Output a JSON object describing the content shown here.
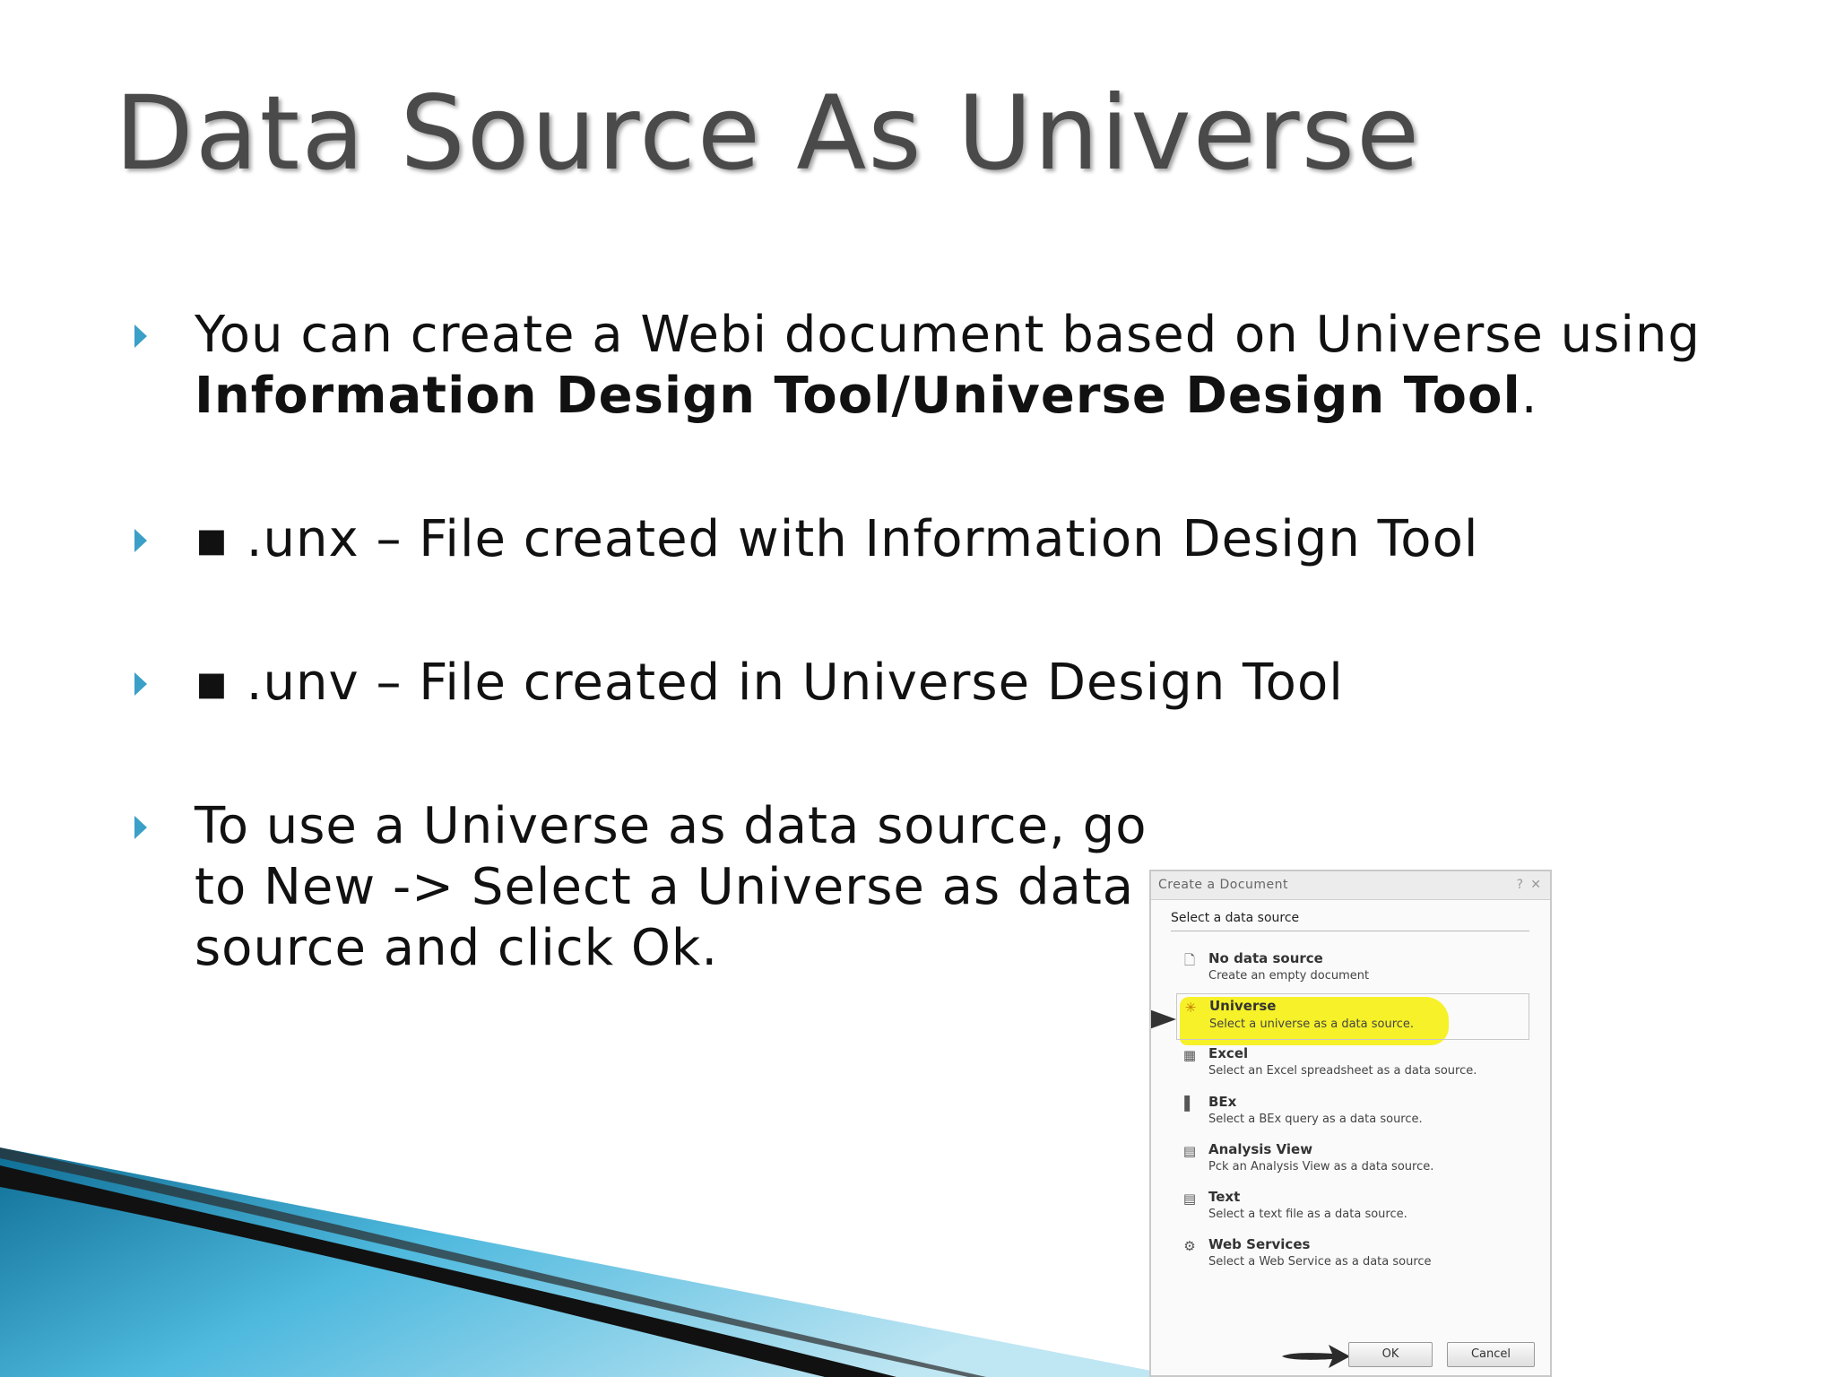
{
  "slide": {
    "title": "Data Source As Universe",
    "bullets": [
      {
        "text": "You can create a Webi document based on Universe using ",
        "bold": "Information Design Tool/Universe Design Tool",
        "tail": "."
      },
      {
        "text": "▪ .unx – File created with Information Design Tool"
      },
      {
        "text": "▪ .unv – File created in Universe Design Tool"
      },
      {
        "text": "To use a Universe as data source, go to New -> Select a Universe as data source and click Ok."
      }
    ]
  },
  "dialog": {
    "title": "Create a Document",
    "help_icon": "?",
    "close_icon": "✕",
    "subtitle": "Select a data source",
    "options": [
      {
        "icon": "document-icon",
        "name": "No data source",
        "desc": "Create an empty document"
      },
      {
        "icon": "universe-icon",
        "name": "Universe",
        "desc": "Select a universe as a data source.",
        "selected": true
      },
      {
        "icon": "excel-icon",
        "name": "Excel",
        "desc": "Select an Excel spreadsheet as a data source."
      },
      {
        "icon": "bex-icon",
        "name": "BEx",
        "desc": "Select a BEx query as a data source."
      },
      {
        "icon": "analysis-view-icon",
        "name": "Analysis View",
        "desc": "Pck an Analysis View as a data source."
      },
      {
        "icon": "text-file-icon",
        "name": "Text",
        "desc": "Select a text file as a data source."
      },
      {
        "icon": "web-services-icon",
        "name": "Web Services",
        "desc": "Select a Web Service as a data source"
      }
    ],
    "ok_label": "OK",
    "cancel_label": "Cancel"
  },
  "colors": {
    "bullet_arrow": "#3aa0c8",
    "highlight": "#f5f01e",
    "title": "#4a4a4a"
  }
}
